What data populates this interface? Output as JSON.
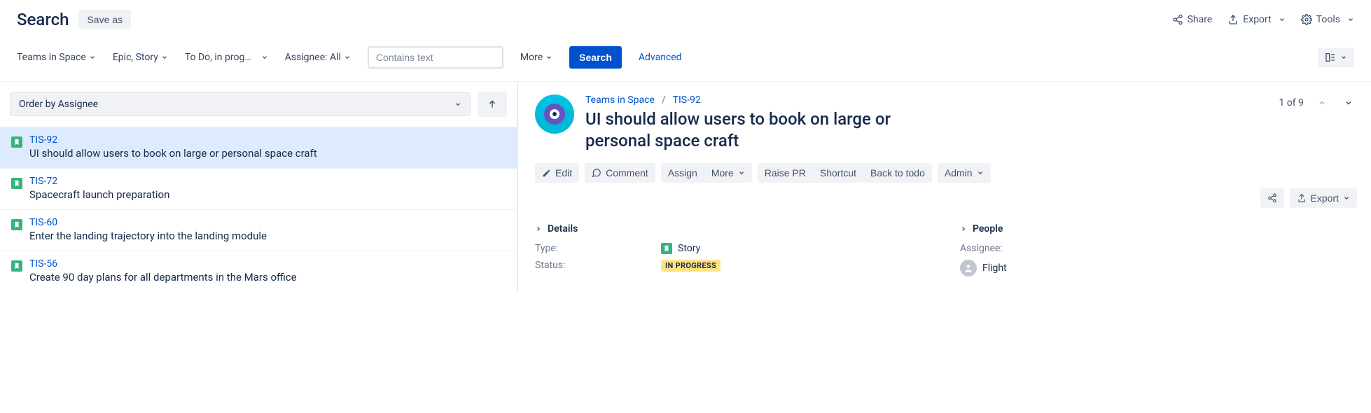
{
  "header": {
    "title": "Search",
    "save_as": "Save as",
    "share": "Share",
    "export": "Export",
    "tools": "Tools"
  },
  "filters": {
    "project": "Teams in Space",
    "type": "Epic, Story",
    "status": "To Do, in prog…",
    "assignee": "Assignee: All",
    "text_placeholder": "Contains text",
    "more": "More",
    "search": "Search",
    "advanced": "Advanced"
  },
  "left": {
    "order_label": "Order by Assignee",
    "issues": [
      {
        "key": "TIS-92",
        "summary": "UI should allow users to book on large or personal space craft",
        "selected": true
      },
      {
        "key": "TIS-72",
        "summary": "Spacecraft launch preparation",
        "selected": false
      },
      {
        "key": "TIS-60",
        "summary": "Enter the landing trajectory into the landing module",
        "selected": false
      },
      {
        "key": "TIS-56",
        "summary": "Create 90 day plans for all departments in the Mars office",
        "selected": false
      }
    ]
  },
  "detail": {
    "project": "Teams in Space",
    "key": "TIS-92",
    "title": "UI should allow users to book on large or personal space craft",
    "count": "1 of 9",
    "actions": {
      "edit": "Edit",
      "comment": "Comment",
      "assign": "Assign",
      "more": "More",
      "raise_pr": "Raise PR",
      "shortcut": "Shortcut",
      "back_to_todo": "Back to todo",
      "admin": "Admin",
      "export": "Export"
    },
    "panels": {
      "details_title": "Details",
      "people_title": "People",
      "type_label": "Type:",
      "type_value": "Story",
      "status_label": "Status:",
      "status_value": "IN PROGRESS",
      "assignee_label": "Assignee:",
      "assignee_value": "Flight"
    }
  }
}
